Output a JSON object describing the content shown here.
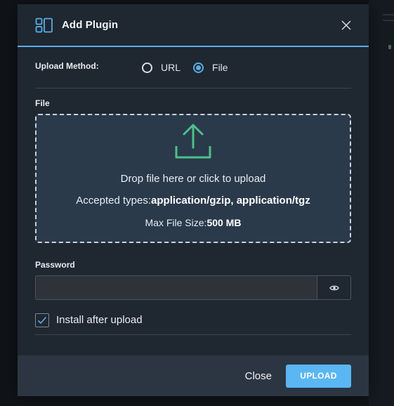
{
  "dialog": {
    "title": "Add Plugin",
    "logo_icon": "plugin-layout-icon",
    "close_icon": "close-icon"
  },
  "upload_method": {
    "label": "Upload Method:",
    "options": [
      {
        "label": "URL",
        "selected": false
      },
      {
        "label": "File",
        "selected": true
      }
    ]
  },
  "file": {
    "label": "File",
    "icon": "upload-arrow-icon",
    "drop_text": "Drop file here or click to upload",
    "types_prefix": "Accepted types:",
    "types_value": "application/gzip, application/tgz",
    "size_prefix": "Max File Size:",
    "size_value": "500 MB"
  },
  "password": {
    "label": "Password",
    "value": "",
    "placeholder": "",
    "toggle_icon": "eye-icon"
  },
  "install_after_upload": {
    "label": "Install after upload",
    "checked": true
  },
  "footer": {
    "close_label": "Close",
    "upload_label": "UPLOAD"
  },
  "colors": {
    "accent": "#5aaee8",
    "upload_button": "#5bb6f4",
    "upload_icon": "#4ec08a",
    "dialog_bg": "#1f2731",
    "dropzone_bg": "#2a3a4b",
    "footer_bg": "#2b3642"
  }
}
